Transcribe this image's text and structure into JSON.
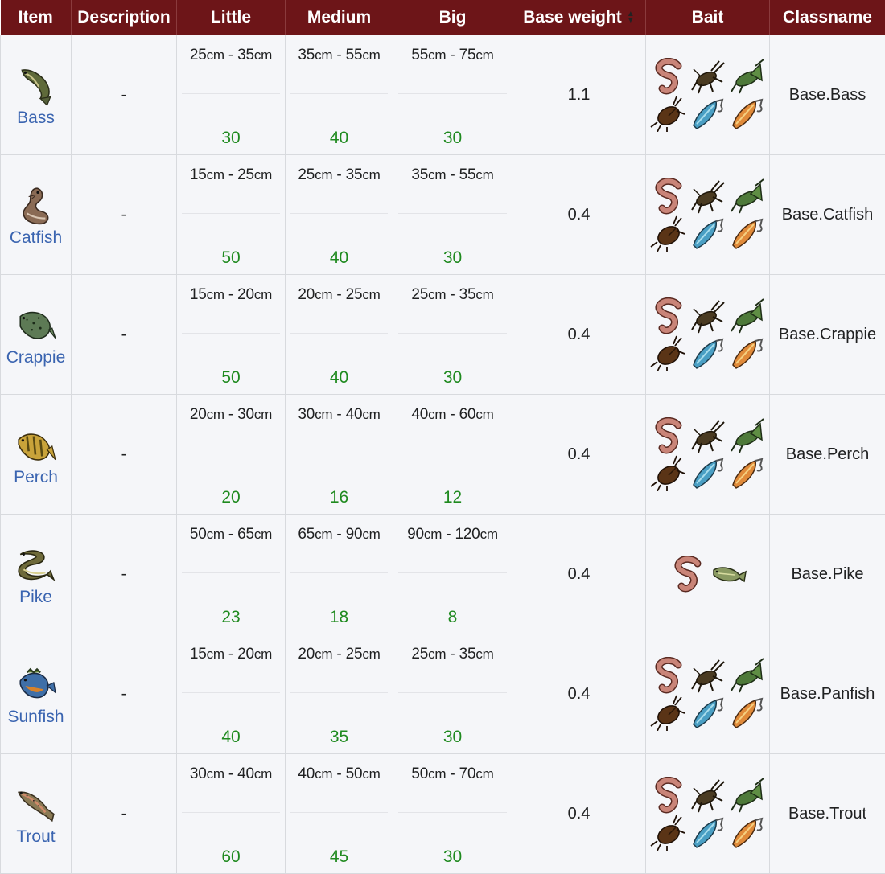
{
  "headers": {
    "item": "Item",
    "description": "Description",
    "little": "Little",
    "medium": "Medium",
    "big": "Big",
    "base_weight": "Base weight",
    "bait": "Bait",
    "classname": "Classname"
  },
  "unit": "cm",
  "rows": [
    {
      "name": "Bass",
      "icon": "bass-icon",
      "description": "-",
      "little": {
        "min": "25",
        "max": "35",
        "chance": "30"
      },
      "medium": {
        "min": "35",
        "max": "55",
        "chance": "40"
      },
      "big": {
        "min": "55",
        "max": "75",
        "chance": "30"
      },
      "base_weight": "1.1",
      "baits": [
        "worm-icon",
        "cricket-icon",
        "grasshopper-icon",
        "cockroach-icon",
        "blue-lure-icon",
        "orange-lure-icon"
      ],
      "classname": "Base.Bass"
    },
    {
      "name": "Catfish",
      "icon": "catfish-icon",
      "description": "-",
      "little": {
        "min": "15",
        "max": "25",
        "chance": "50"
      },
      "medium": {
        "min": "25",
        "max": "35",
        "chance": "40"
      },
      "big": {
        "min": "35",
        "max": "55",
        "chance": "30"
      },
      "base_weight": "0.4",
      "baits": [
        "worm-icon",
        "cricket-icon",
        "grasshopper-icon",
        "cockroach-icon",
        "blue-lure-icon",
        "orange-lure-icon"
      ],
      "classname": "Base.Catfish"
    },
    {
      "name": "Crappie",
      "icon": "crappie-icon",
      "description": "-",
      "little": {
        "min": "15",
        "max": "20",
        "chance": "50"
      },
      "medium": {
        "min": "20",
        "max": "25",
        "chance": "40"
      },
      "big": {
        "min": "25",
        "max": "35",
        "chance": "30"
      },
      "base_weight": "0.4",
      "baits": [
        "worm-icon",
        "cricket-icon",
        "grasshopper-icon",
        "cockroach-icon",
        "blue-lure-icon",
        "orange-lure-icon"
      ],
      "classname": "Base.Crappie"
    },
    {
      "name": "Perch",
      "icon": "perch-icon",
      "description": "-",
      "little": {
        "min": "20",
        "max": "30",
        "chance": "20"
      },
      "medium": {
        "min": "30",
        "max": "40",
        "chance": "16"
      },
      "big": {
        "min": "40",
        "max": "60",
        "chance": "12"
      },
      "base_weight": "0.4",
      "baits": [
        "worm-icon",
        "cricket-icon",
        "grasshopper-icon",
        "cockroach-icon",
        "blue-lure-icon",
        "orange-lure-icon"
      ],
      "classname": "Base.Perch"
    },
    {
      "name": "Pike",
      "icon": "pike-icon",
      "description": "-",
      "little": {
        "min": "50",
        "max": "65",
        "chance": "23"
      },
      "medium": {
        "min": "65",
        "max": "90",
        "chance": "18"
      },
      "big": {
        "min": "90",
        "max": "120",
        "chance": "8"
      },
      "base_weight": "0.4",
      "baits": [
        "worm-icon",
        "small-fish-icon"
      ],
      "classname": "Base.Pike"
    },
    {
      "name": "Sunfish",
      "icon": "sunfish-icon",
      "description": "-",
      "little": {
        "min": "15",
        "max": "20",
        "chance": "40"
      },
      "medium": {
        "min": "20",
        "max": "25",
        "chance": "35"
      },
      "big": {
        "min": "25",
        "max": "35",
        "chance": "30"
      },
      "base_weight": "0.4",
      "baits": [
        "worm-icon",
        "cricket-icon",
        "grasshopper-icon",
        "cockroach-icon",
        "blue-lure-icon",
        "orange-lure-icon"
      ],
      "classname": "Base.Panfish"
    },
    {
      "name": "Trout",
      "icon": "trout-icon",
      "description": "-",
      "little": {
        "min": "30",
        "max": "40",
        "chance": "60"
      },
      "medium": {
        "min": "40",
        "max": "50",
        "chance": "45"
      },
      "big": {
        "min": "50",
        "max": "70",
        "chance": "30"
      },
      "base_weight": "0.4",
      "baits": [
        "worm-icon",
        "cricket-icon",
        "grasshopper-icon",
        "cockroach-icon",
        "blue-lure-icon",
        "orange-lure-icon"
      ],
      "classname": "Base.Trout"
    }
  ]
}
